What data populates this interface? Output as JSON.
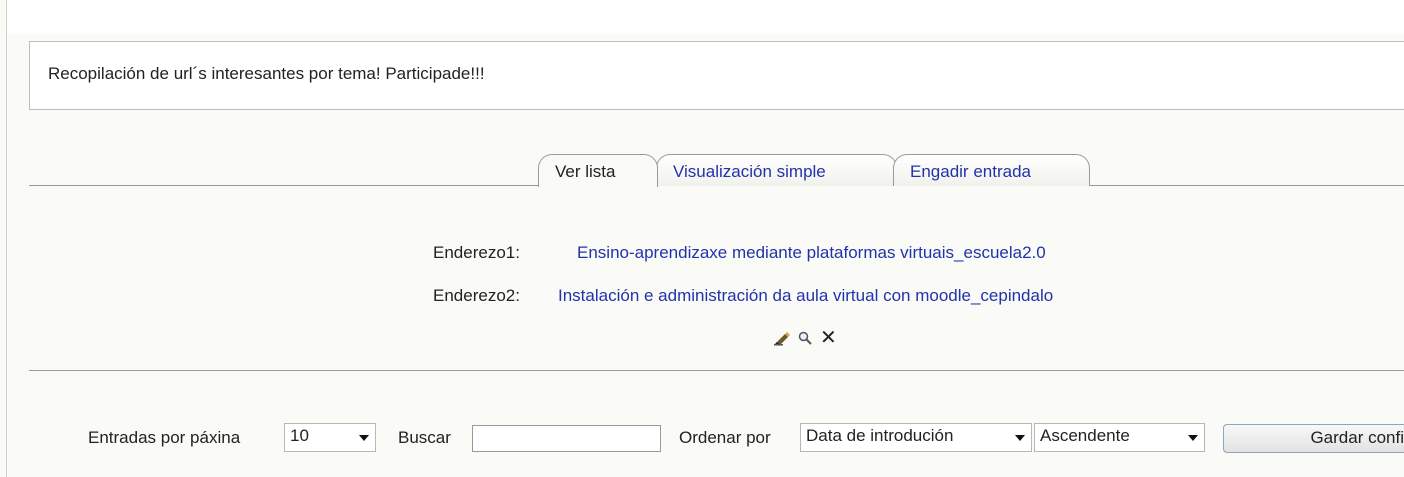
{
  "intro": {
    "text": "Recopilación de url´s interesantes por tema! Participade!!!"
  },
  "tabs": [
    {
      "label": "Ver lista",
      "active": true
    },
    {
      "label": "Visualización simple",
      "active": false
    },
    {
      "label": "Engadir entrada",
      "active": false
    }
  ],
  "entry": {
    "rows": [
      {
        "label": "Enderezo1:",
        "value": "Ensino-aprendizaxe mediante plataformas virtuais_escuela2.0"
      },
      {
        "label": "Enderezo2:",
        "value": "Instalación e administración da aula virtual con moodle_cepindalo"
      }
    ],
    "actions": [
      "edit-icon",
      "magnifier-icon",
      "delete-icon"
    ]
  },
  "controls": {
    "per_page_label": "Entradas por páxina",
    "per_page_value": "10",
    "search_label": "Buscar",
    "search_value": "",
    "order_label": "Ordenar por",
    "order_value": "Data de introdución",
    "direction_value": "Ascendente",
    "save_label": "Gardar confi"
  },
  "colors": {
    "link": "#2233aa",
    "background": "#fafaf7"
  }
}
